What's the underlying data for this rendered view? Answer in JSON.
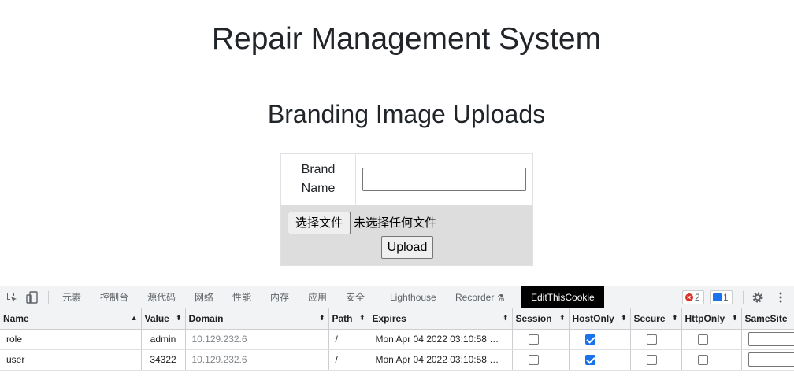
{
  "page": {
    "title": "Repair Management System",
    "section_title": "Branding Image Uploads"
  },
  "form": {
    "brand_label": "Brand Name",
    "brand_value": "",
    "choose_file_label": "选择文件",
    "file_status": "未选择任何文件",
    "upload_label": "Upload"
  },
  "devtools": {
    "tabs": [
      "元素",
      "控制台",
      "源代码",
      "网络",
      "性能",
      "内存",
      "应用",
      "安全",
      "Lighthouse",
      "Recorder",
      "EditThisCookie"
    ],
    "active_tab": "EditThisCookie",
    "error_count": "2",
    "message_count": "1",
    "columns": [
      "Name",
      "Value",
      "Domain",
      "Path",
      "Expires",
      "Session",
      "HostOnly",
      "Secure",
      "HttpOnly",
      "SameSite"
    ],
    "cookies": [
      {
        "name": "role",
        "value": "admin",
        "domain": "10.129.232.6",
        "path": "/",
        "expires": "Mon Apr 04 2022 03:10:58 …",
        "session": false,
        "hostonly": true,
        "secure": false,
        "httponly": false
      },
      {
        "name": "user",
        "value": "34322",
        "domain": "10.129.232.6",
        "path": "/",
        "expires": "Mon Apr 04 2022 03:10:58 …",
        "session": false,
        "hostonly": true,
        "secure": false,
        "httponly": false
      }
    ],
    "colors": {
      "accent": "#1a73e8",
      "error": "#d93025",
      "active_tab_bg": "#000000"
    }
  }
}
